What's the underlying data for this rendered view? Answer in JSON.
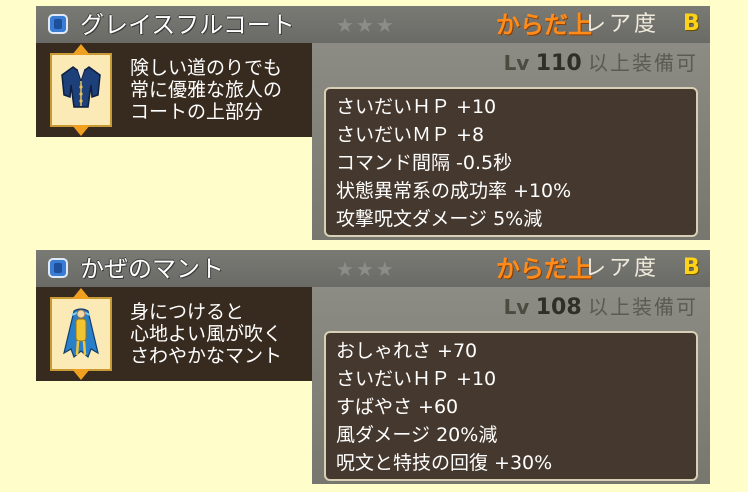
{
  "cards": [
    {
      "name": "グレイスフルコート",
      "stars": "★★★",
      "slot": "からだ上",
      "rarity_label": "レア度",
      "rarity_grade": "B",
      "level_prefix": "Lv",
      "level": "110",
      "level_suffix": "以上装備可",
      "description": [
        "険しい道のりでも",
        "常に優雅な旅人の",
        "コートの上部分"
      ],
      "stats": [
        "さいだいＨＰ +10",
        "さいだいＭＰ +8",
        "コマンド間隔 -0.5秒",
        "状態異常系の成功率 +10%",
        "攻撃呪文ダメージ 5%減"
      ],
      "icon": "blue-coat-icon",
      "colors": {
        "icon_main": "#1d3f7a",
        "icon_accent": "#e6c35a"
      }
    },
    {
      "name": "かぜのマント",
      "stars": "★★★",
      "slot": "からだ上",
      "rarity_label": "レア度",
      "rarity_grade": "B",
      "level_prefix": "Lv",
      "level": "108",
      "level_suffix": "以上装備可",
      "description": [
        "身につけると",
        "心地よい風が吹く",
        "さわやかなマント"
      ],
      "stats": [
        "おしゃれさ +70",
        "さいだいＨＰ +10",
        "すばやさ +60",
        "風ダメージ 20%減",
        "呪文と特技の回復 +30%"
      ],
      "icon": "wind-cape-icon",
      "colors": {
        "icon_main": "#2a7fc9",
        "icon_accent": "#f2c432"
      }
    }
  ],
  "colors": {
    "page_background": "#fffdc9",
    "title_bar": "#6f6f6b",
    "slot_text": "#ff8c1a",
    "grade_text": "#ffd21a",
    "description_panel": "#372a1e",
    "stats_box": "#45382e"
  }
}
